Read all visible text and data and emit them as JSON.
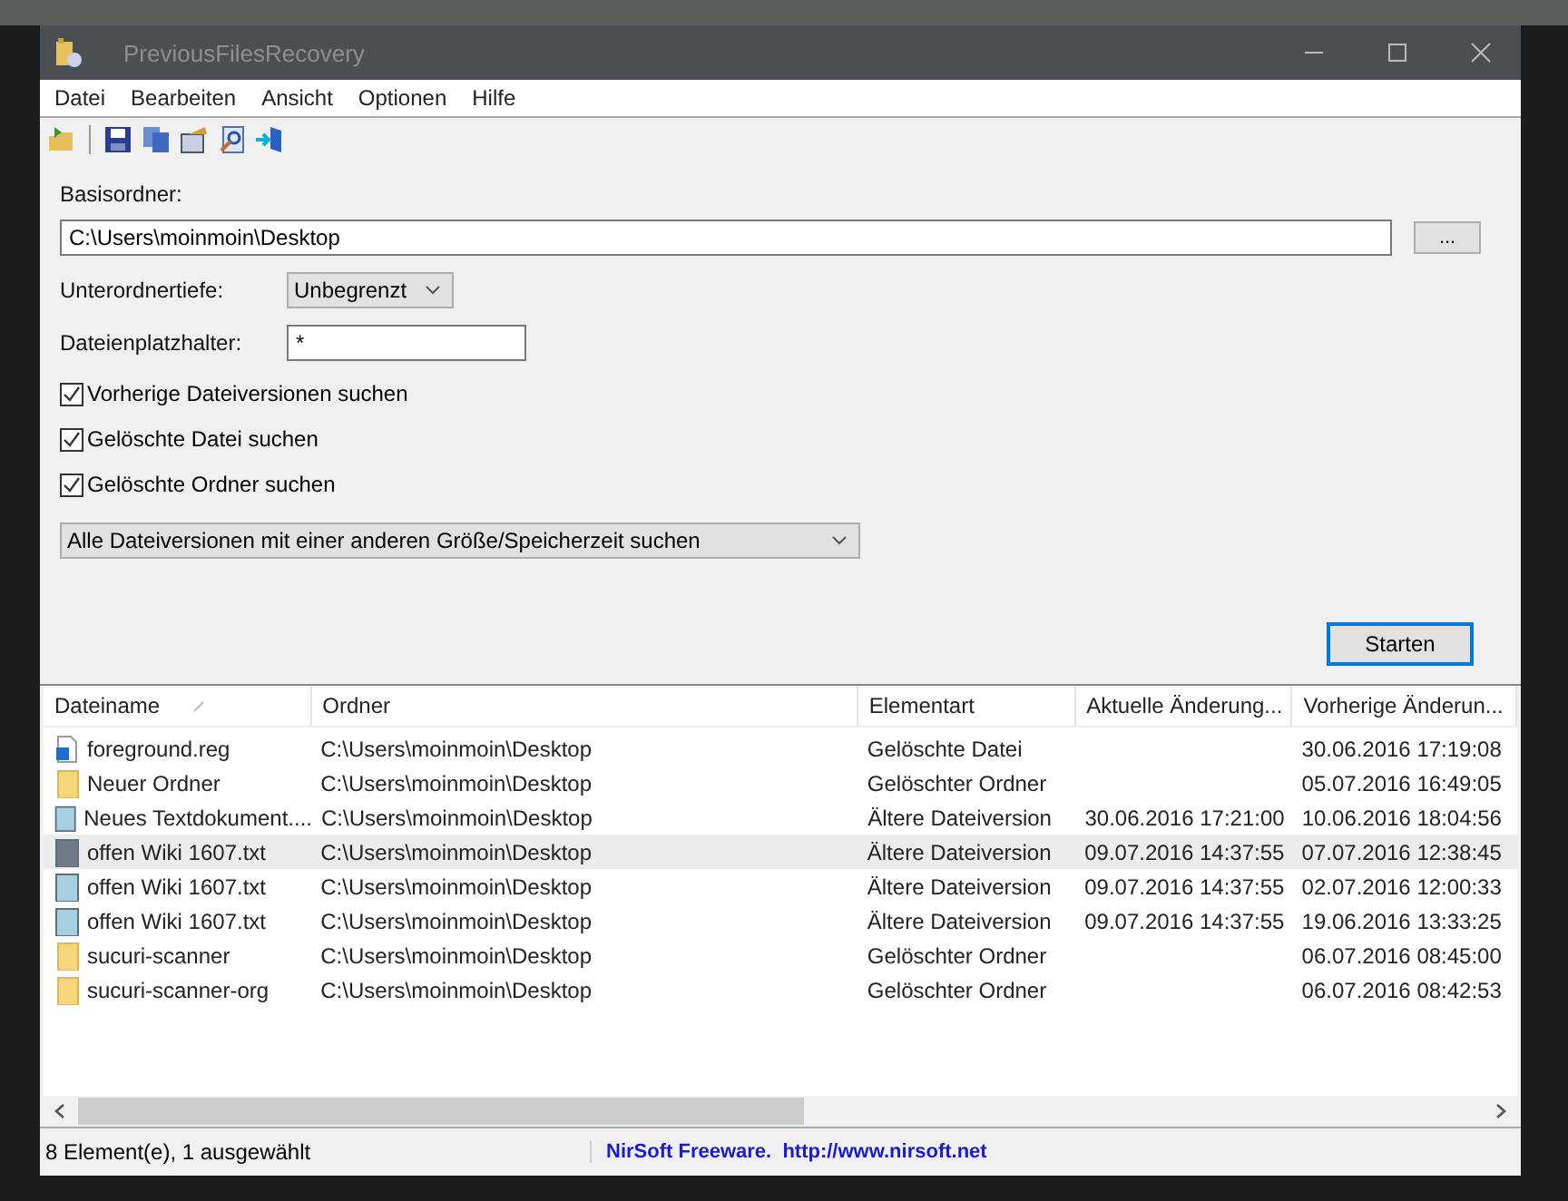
{
  "window": {
    "title": "PreviousFilesRecovery"
  },
  "menu": [
    "Datei",
    "Bearbeiten",
    "Ansicht",
    "Optionen",
    "Hilfe"
  ],
  "form": {
    "base_folder": {
      "label": "Basisordner:",
      "value": "C:\\Users\\moinmoin\\Desktop",
      "browse": "..."
    },
    "depth": {
      "label": "Unterordnertiefe:",
      "value": "Unbegrenzt"
    },
    "wildcard": {
      "label": "Dateienplatzhalter:",
      "value": "*"
    },
    "options": [
      {
        "label": "Vorherige Dateiversionen suchen",
        "checked": true
      },
      {
        "label": "Gelöschte Datei suchen",
        "checked": true
      },
      {
        "label": "Gelöschte Ordner suchen",
        "checked": true
      }
    ],
    "mode": {
      "value": "Alle Dateiversionen mit einer anderen Größe/Speicherzeit suchen"
    },
    "start_button": "Starten"
  },
  "table": {
    "columns": [
      {
        "label": "Dateiname",
        "sorted": true
      },
      {
        "label": "Ordner",
        "sorted": false
      },
      {
        "label": "Elementart",
        "sorted": false
      },
      {
        "label": "Aktuelle Änderung...",
        "sorted": false
      },
      {
        "label": "Vorherige Änderun...",
        "sorted": false
      }
    ],
    "rows": [
      {
        "kind": "reg",
        "selected": false,
        "cells": [
          "foreground.reg",
          "C:\\Users\\moinmoin\\Desktop",
          "Gelöschte Datei",
          "",
          "30.06.2016 17:19:08"
        ]
      },
      {
        "kind": "folder",
        "selected": false,
        "cells": [
          "Neuer Ordner",
          "C:\\Users\\moinmoin\\Desktop",
          "Gelöschter Ordner",
          "",
          "05.07.2016 16:49:05"
        ]
      },
      {
        "kind": "text",
        "selected": false,
        "cells": [
          "Neues Textdokument....",
          "C:\\Users\\moinmoin\\Desktop",
          "Ältere Dateiversion",
          "30.06.2016 17:21:00",
          "10.06.2016 18:04:56"
        ]
      },
      {
        "kind": "text",
        "selected": true,
        "cells": [
          "offen Wiki 1607.txt",
          "C:\\Users\\moinmoin\\Desktop",
          "Ältere Dateiversion",
          "09.07.2016 14:37:55",
          "07.07.2016 12:38:45"
        ]
      },
      {
        "kind": "text",
        "selected": false,
        "cells": [
          "offen Wiki 1607.txt",
          "C:\\Users\\moinmoin\\Desktop",
          "Ältere Dateiversion",
          "09.07.2016 14:37:55",
          "02.07.2016 12:00:33"
        ]
      },
      {
        "kind": "text",
        "selected": false,
        "cells": [
          "offen Wiki 1607.txt",
          "C:\\Users\\moinmoin\\Desktop",
          "Ältere Dateiversion",
          "09.07.2016 14:37:55",
          "19.06.2016 13:33:25"
        ]
      },
      {
        "kind": "folder",
        "selected": false,
        "cells": [
          "sucuri-scanner",
          "C:\\Users\\moinmoin\\Desktop",
          "Gelöschter Ordner",
          "",
          "06.07.2016 08:45:00"
        ]
      },
      {
        "kind": "folder",
        "selected": false,
        "cells": [
          "sucuri-scanner-org",
          "C:\\Users\\moinmoin\\Desktop",
          "Gelöschter Ordner",
          "",
          "06.07.2016 08:42:53"
        ]
      }
    ]
  },
  "status_bar": {
    "count": "8 Element(e), 1 ausgewählt",
    "credit": "NirSoft Freeware.  http://www.nirsoft.net"
  }
}
